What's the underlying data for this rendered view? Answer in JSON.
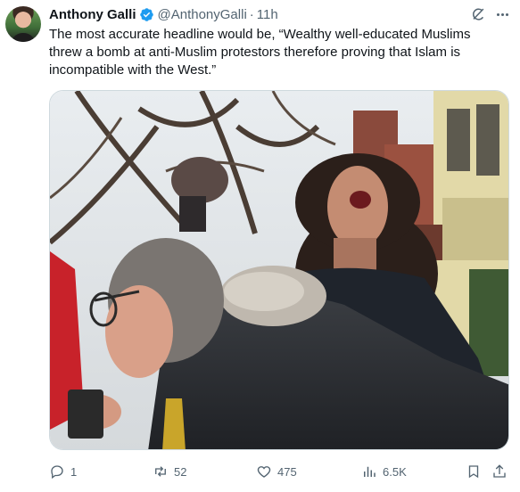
{
  "tweet": {
    "author_name": "Anthony Galli",
    "handle": "@AnthonyGalli",
    "separator": "·",
    "time": "11h",
    "text": "The most accurate headline would be, “Wealthy well-educated Muslims threw a bomb at anti-Muslim protestors therefore proving that Islam is incompatible with the West.”"
  },
  "actions": {
    "replies": "1",
    "retweets": "52",
    "likes": "475",
    "views": "6.5K"
  },
  "colors": {
    "verified_badge": "#1d9bf0",
    "secondary_text": "#536471",
    "primary_text": "#0f1419",
    "border": "#cfd9de"
  },
  "icons": [
    "verified-badge-icon",
    "grok-icon",
    "more-icon",
    "reply-icon",
    "retweet-icon",
    "like-icon",
    "views-icon",
    "bookmark-icon",
    "share-icon"
  ]
}
